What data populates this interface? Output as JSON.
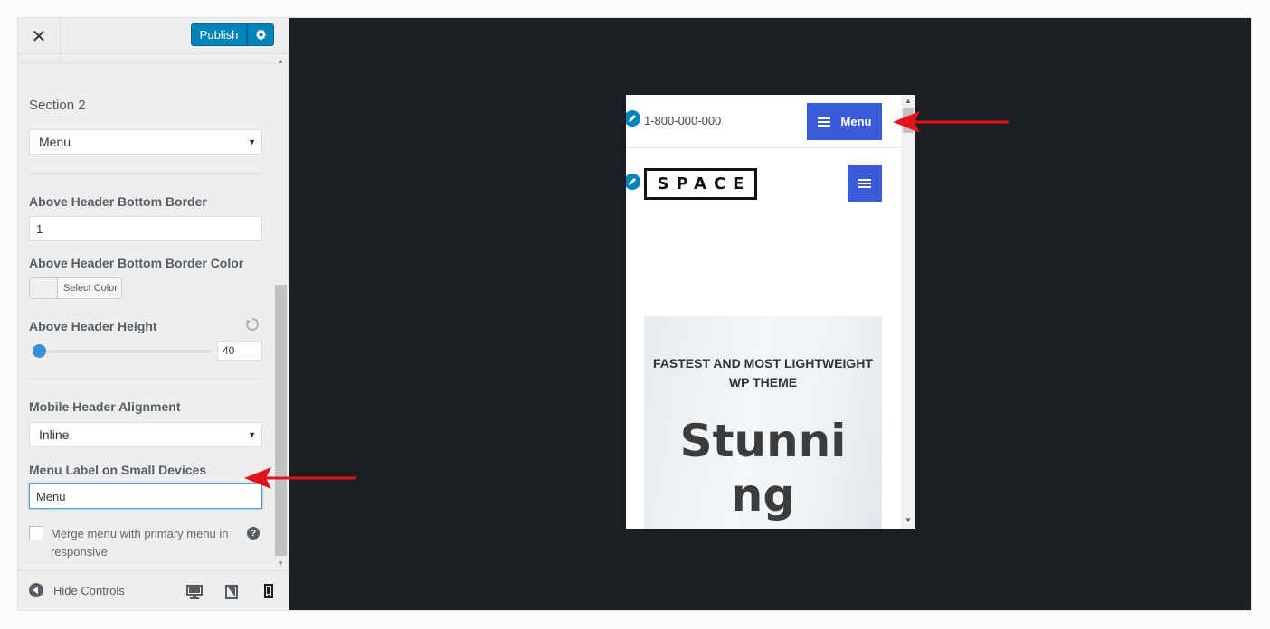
{
  "topbar": {
    "close_icon": "close-icon",
    "publish_label": "Publish",
    "settings_icon": "gear-icon"
  },
  "controls": {
    "section_label": "Section 2",
    "section_select": "Menu",
    "bottom_border_label": "Above Header Bottom Border",
    "bottom_border_value": "1",
    "border_color_label": "Above Header Bottom Border Color",
    "select_color_label": "Select Color",
    "height_label": "Above Header Height",
    "height_value": "40",
    "height_fraction": 0.0,
    "alignment_label": "Mobile Header Alignment",
    "alignment_select": "Inline",
    "menu_label_label": "Menu Label on Small Devices",
    "menu_label_value": "Menu",
    "merge_label": "Merge menu with primary menu in responsive",
    "merge_checked": false
  },
  "footer": {
    "hide_controls": "Hide Controls",
    "devices": [
      "desktop-icon",
      "tablet-icon",
      "mobile-icon"
    ],
    "active_device": "mobile"
  },
  "preview": {
    "phone": "1-800-000-000",
    "menu_button": "Menu",
    "logo": "SPACE",
    "hero_subtitle": "FASTEST AND MOST LIGHTWEIGHT WP THEME",
    "hero_title": "Stunning"
  },
  "colors": {
    "accent": "#0085ba",
    "menu_button": "#3a5bd9",
    "arrow": "#e3131b",
    "canvas": "#1b1f23"
  }
}
